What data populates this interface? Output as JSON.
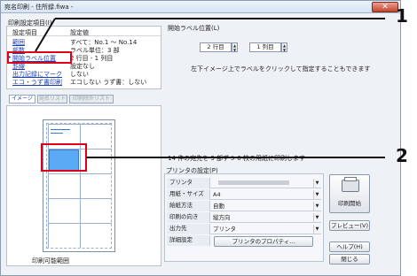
{
  "title": "宛名印刷 - 住所録.fiwa -",
  "close_glyph": "✕",
  "print_settings": {
    "group_label": "印刷設定項目(I)",
    "col_item": "設定項目",
    "col_value": "設定値",
    "rows": [
      {
        "item": "範囲",
        "value": "すべて：No.1 ～ No.14"
      },
      {
        "item": "部数",
        "value": "ラベル単位：3 部"
      },
      {
        "item": "開始ラベル位置",
        "value": "2 行目 - 1 列目"
      },
      {
        "item": "罫線",
        "value": "設定なし"
      },
      {
        "item": "出力記録にマーク",
        "value": "しない"
      },
      {
        "item": "エコ・うず書印刷",
        "value": "エコしない うず書：しない"
      }
    ]
  },
  "tabs": [
    "イメージ",
    "宛名リスト",
    "印刷除外リスト"
  ],
  "preview_caption": "印刷可能範囲",
  "start_label": {
    "group_label": "開始ラベル位置(L)",
    "row_value": "2",
    "row_suffix": "行目",
    "col_value": "1",
    "col_suffix": "列目",
    "hint": "左下イメージ上でラベルをクリックして指定することもできます"
  },
  "info_line": "14 件の宛先を 3 部ずつ 6 枚の用紙に印刷します",
  "printer": {
    "group_label": "プリンタの設定(P)",
    "rows": [
      {
        "label": "プリンタ",
        "value": ""
      },
      {
        "label": "用紙・サイズ",
        "value": "A4"
      },
      {
        "label": "給紙方法",
        "value": "自動"
      },
      {
        "label": "印刷の向き",
        "value": "縦方向"
      },
      {
        "label": "出力先",
        "value": "プリンタ"
      },
      {
        "label": "詳細設定",
        "value": ""
      }
    ],
    "properties_button": "プリンタのプロパティ..."
  },
  "buttons": {
    "print": "印刷開始",
    "preview": "プレビュー(V)",
    "help": "ヘルプ(H)",
    "close": "閉じる"
  },
  "callouts": [
    "1",
    "2"
  ],
  "colors": {
    "highlight": "#e0001a",
    "selected_label": "#5aaaf5"
  }
}
